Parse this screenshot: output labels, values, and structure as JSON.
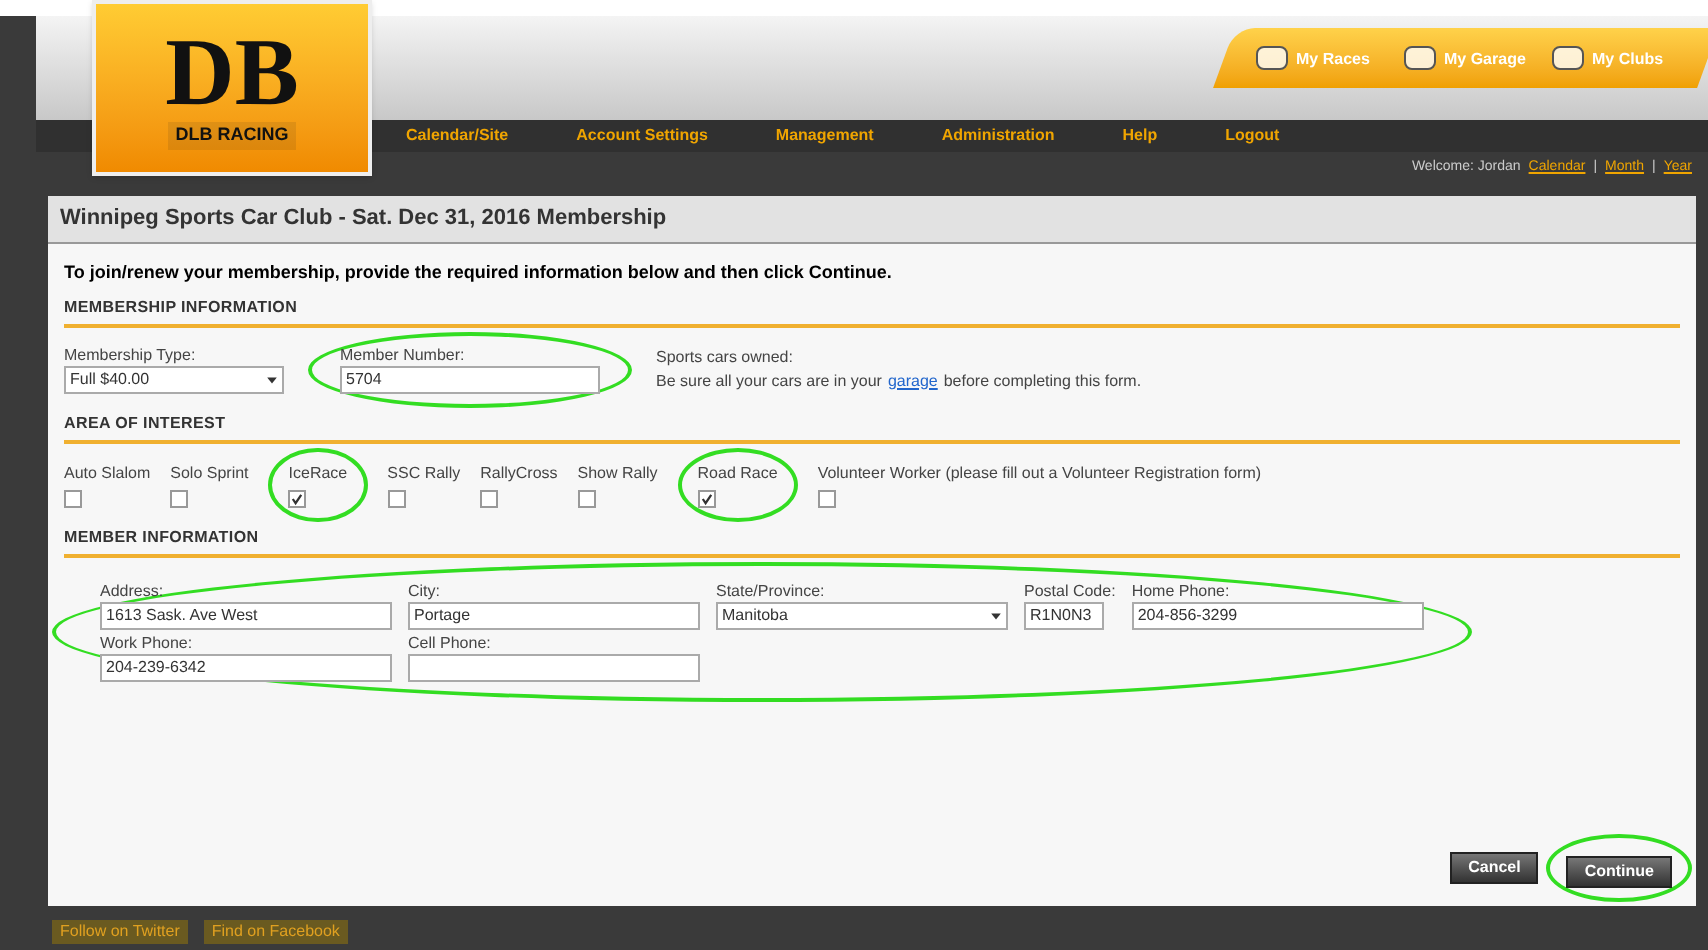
{
  "logo": {
    "text": "DB",
    "subtitle": "DLB RACING"
  },
  "quick_links": [
    {
      "label": "My Races"
    },
    {
      "label": "My Garage"
    },
    {
      "label": "My Clubs"
    }
  ],
  "nav": [
    "Calendar/Site",
    "Account Settings",
    "Management",
    "Administration",
    "Help",
    "Logout"
  ],
  "welcome": {
    "text": "Welcome: Jordan",
    "links": [
      {
        "kind": "link",
        "text": "Calendar"
      },
      {
        "kind": "separator",
        "text": "|"
      },
      {
        "kind": "link",
        "text": "Month"
      },
      {
        "kind": "separator",
        "text": "|"
      },
      {
        "kind": "link",
        "text": "Year"
      }
    ]
  },
  "page_title": "Winnipeg Sports Car Club - Sat. Dec 31, 2016 Membership",
  "intro": "To join/renew your membership, provide the required information below and then click Continue.",
  "membership": {
    "heading": "MEMBERSHIP INFORMATION",
    "type": {
      "label": "Membership Type:",
      "value": "Full $40.00"
    },
    "number": {
      "label": "Member Number:",
      "value": "5704",
      "circled": true
    },
    "cars": {
      "label": "Sports cars owned:",
      "before": "Be sure all your cars are in your",
      "link": "garage",
      "after": "before completing this form."
    }
  },
  "interests": {
    "heading": "AREA OF INTEREST",
    "items": [
      {
        "label": "Auto Slalom",
        "checked": false,
        "circled": false
      },
      {
        "label": "Solo Sprint",
        "checked": false,
        "circled": false
      },
      {
        "label": "IceRace",
        "checked": true,
        "circled": true
      },
      {
        "label": "SSC Rally",
        "checked": false,
        "circled": false
      },
      {
        "label": "RallyCross",
        "checked": false,
        "circled": false
      },
      {
        "label": "Show Rally",
        "checked": false,
        "circled": false
      },
      {
        "label": "Road Race",
        "checked": true,
        "circled": true
      },
      {
        "label": "Volunteer Worker (please fill out a Volunteer Registration form)",
        "checked": false,
        "circled": false
      }
    ]
  },
  "member_info": {
    "heading": "MEMBER INFORMATION",
    "circled": true,
    "rows": [
      [
        {
          "label": "Address:",
          "value": "1613 Sask. Ave West",
          "kind": "text"
        },
        {
          "label": "City:",
          "value": "Portage",
          "kind": "text"
        },
        {
          "label": "State/Province:",
          "value": "Manitoba",
          "kind": "select"
        },
        {
          "label": "Postal Code:",
          "value": "R1N0N3",
          "kind": "short"
        },
        {
          "label": "Home Phone:",
          "value": "204-856-3299",
          "kind": "text"
        }
      ],
      [
        {
          "label": "Work Phone:",
          "value": "204-239-6342",
          "kind": "text"
        },
        {
          "label": "Cell Phone:",
          "kind": "text"
        }
      ]
    ]
  },
  "buttons": [
    {
      "label": "Cancel",
      "circled": false
    },
    {
      "label": "Continue",
      "circled": true
    }
  ],
  "footer": [
    "Follow on Twitter",
    "Find on Facebook"
  ]
}
